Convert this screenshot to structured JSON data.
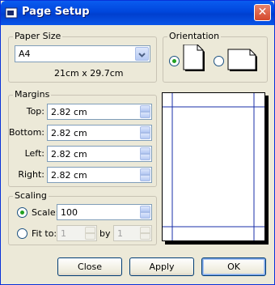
{
  "window": {
    "title": "Page Setup",
    "close_glyph": "✕",
    "icon": "page-setup-icon"
  },
  "paper_size": {
    "group_label": "Paper Size",
    "selected": "A4",
    "dimensions": "21cm x 29.7cm"
  },
  "orientation": {
    "group_label": "Orientation",
    "selected": "portrait"
  },
  "margins": {
    "group_label": "Margins",
    "fields": [
      {
        "label": "Top:",
        "value": "2.82 cm"
      },
      {
        "label": "Bottom:",
        "value": "2.82 cm"
      },
      {
        "label": "Left:",
        "value": "2.82 cm"
      },
      {
        "label": "Right:",
        "value": "2.82 cm"
      }
    ]
  },
  "scaling": {
    "group_label": "Scaling",
    "scale_label": "Scale:",
    "scale_value": "100",
    "fit_label": "Fit to:",
    "fit_width": "1",
    "by_label": "by",
    "fit_height": "1",
    "selected": "scale"
  },
  "buttons": {
    "close": "Close",
    "apply": "Apply",
    "ok": "OK"
  },
  "colors": {
    "title_bar": "#0046dc",
    "margin_lines": "#1a2fa8",
    "radio_dot": "#21a121"
  }
}
